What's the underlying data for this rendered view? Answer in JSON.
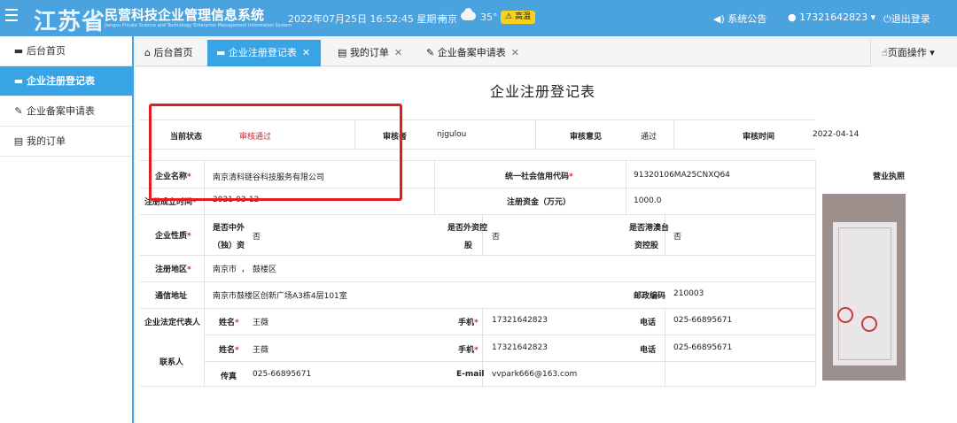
{
  "header": {
    "logo_province": "江苏省",
    "logo_title": "民营科技企业管理信息系统",
    "logo_subtitle": "Jiangsu Private Science and Technology Enterprise Management Information System",
    "datetime": "2022年07月25日 16:52:45 星期一",
    "city": "南京",
    "weather_icon": "cloud-icon",
    "temperature": "35°",
    "heat_badge": "高温",
    "announcement": "系统公告",
    "username": "17321642823",
    "logout": "退出登录",
    "colors": {
      "bar": "#4aa3df",
      "badge": "#f6d21a"
    }
  },
  "sidebar": {
    "items": [
      {
        "label": "后台首页",
        "icon": "monitor-icon",
        "active": false
      },
      {
        "label": "企业注册登记表",
        "icon": "monitor-icon",
        "active": true
      },
      {
        "label": "企业备案申请表",
        "icon": "edit-icon",
        "active": false
      },
      {
        "label": "我的订单",
        "icon": "document-icon",
        "active": false
      }
    ]
  },
  "tabs": [
    {
      "label": "后台首页",
      "icon": "home-icon",
      "closable": false,
      "active": false
    },
    {
      "label": "企业注册登记表",
      "icon": "monitor-icon",
      "closable": true,
      "active": true
    },
    {
      "label": "我的订单",
      "icon": "document-icon",
      "closable": true,
      "active": false
    },
    {
      "label": "企业备案申请表",
      "icon": "edit-icon",
      "closable": true,
      "active": false
    }
  ],
  "page_ops": "页面操作",
  "form": {
    "title": "企业注册登记表",
    "review": {
      "status_label": "当前状态",
      "status_value": "审核通过",
      "reviewer_label": "审核者",
      "reviewer_value": "njgulou",
      "opinion_label": "审核意见",
      "opinion_value": "通过",
      "time_label": "审核时间",
      "time_value": "2022-04-14"
    },
    "company_name_label": "企业名称",
    "company_name": "南京清科链谷科技服务有限公司",
    "credit_code_label": "统一社会信用代码",
    "credit_code": "91320106MA25CNXQ64",
    "license_label": "营业执照",
    "reg_date_label": "注册成立时间",
    "reg_date": "2021-03-12",
    "capital_label": "注册资金（万元）",
    "capital": "1000.0",
    "nature_label": "企业性质",
    "sino_foreign_label_1": "是否中外",
    "sino_foreign_label_2": "（独）资",
    "sino_foreign_value": "否",
    "foreign_holding_label_1": "是否外资控",
    "foreign_holding_label_2": "股",
    "foreign_holding_value": "否",
    "hk_macao_label_1": "是否港澳台",
    "hk_macao_label_2": "资控股",
    "hk_macao_value": "否",
    "region_label": "注册地区",
    "region_city": "南京市",
    "region_sep": "，",
    "region_district": "鼓楼区",
    "address_label": "通信地址",
    "address": "南京市鼓楼区创新广场A3栋4层101室",
    "postcode_label": "邮政编码",
    "postcode": "210003",
    "legal_rep_label": "企业法定代表人",
    "contact_label": "联系人",
    "name_label": "姓名",
    "phone_label": "手机",
    "tel_label": "电话",
    "fax_label": "传真",
    "email_label": "E-mail",
    "legal_rep": {
      "name": "王薇",
      "phone": "17321642823",
      "tel": "025-66895671"
    },
    "contact": {
      "name": "王薇",
      "phone": "17321642823",
      "tel": "025-66895671",
      "fax": "025-66895671",
      "email": "vvpark666@163.com"
    }
  }
}
